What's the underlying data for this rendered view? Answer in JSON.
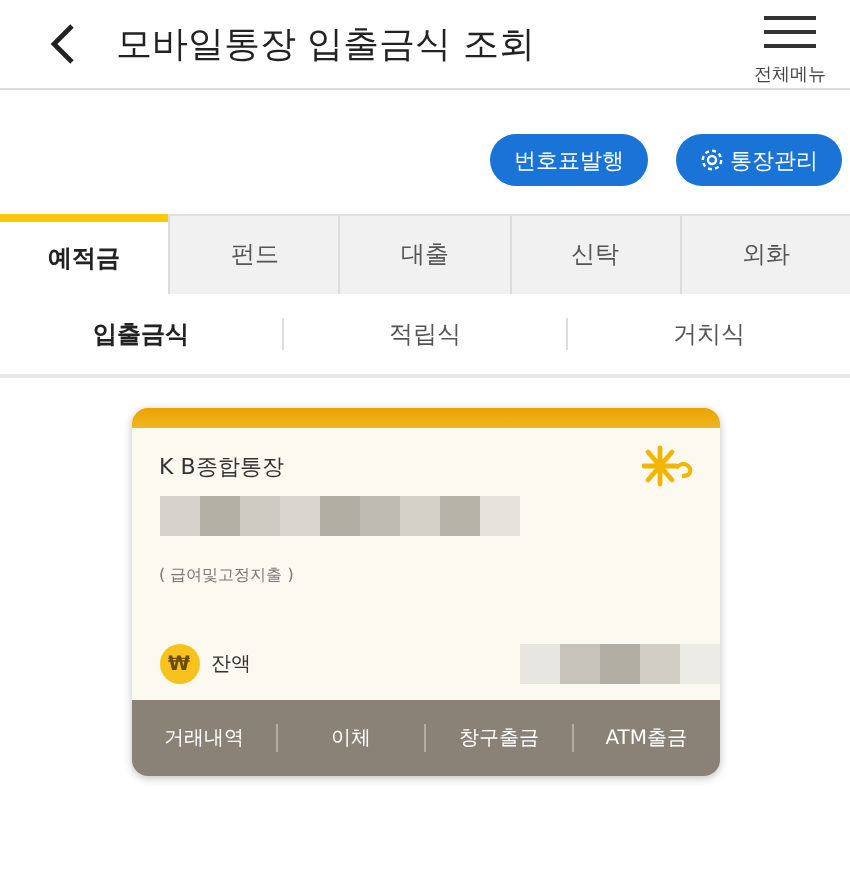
{
  "header": {
    "title": "모바일통장 입출금식 조회",
    "menu_label": "전체메뉴"
  },
  "actions": [
    "번호표발행",
    "통장관리"
  ],
  "tabs": [
    {
      "label": "예적금",
      "selected": true
    },
    {
      "label": "펀드",
      "selected": false
    },
    {
      "label": "대출",
      "selected": false
    },
    {
      "label": "신탁",
      "selected": false
    },
    {
      "label": "외화",
      "selected": false
    }
  ],
  "subtabs": [
    {
      "label": "입출금식",
      "selected": true
    },
    {
      "label": "적립식",
      "selected": false
    },
    {
      "label": "거치식",
      "selected": false
    }
  ],
  "account": {
    "name": "K B종합통장",
    "nickname": "( 급여및고정지출 )",
    "currency_symbol": "₩",
    "balance_label": "잔액",
    "actions": [
      "거래내역",
      "이체",
      "창구출금",
      "ATM출금"
    ]
  }
}
